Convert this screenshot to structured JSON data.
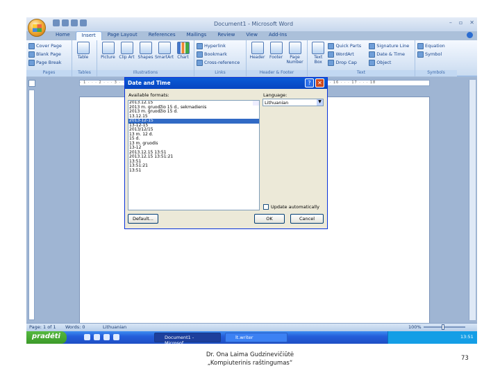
{
  "window": {
    "title": "Document1 - Microsoft Word",
    "controls": [
      "–",
      "▫",
      "✕"
    ]
  },
  "ribbon": {
    "tabs": [
      "Home",
      "Insert",
      "Page Layout",
      "References",
      "Mailings",
      "Review",
      "View",
      "Add-Ins"
    ],
    "active_tab": "Insert",
    "pages": {
      "items": [
        "Cover Page",
        "Blank Page",
        "Page Break"
      ],
      "title": "Pages"
    },
    "tables": {
      "items": [
        "Table"
      ],
      "title": "Tables"
    },
    "illustrations": {
      "items": [
        "Picture",
        "Clip Art",
        "Shapes",
        "SmartArt",
        "Chart"
      ],
      "title": "Illustrations"
    },
    "links": {
      "items": [
        "Hyperlink",
        "Bookmark",
        "Cross-reference"
      ],
      "title": "Links"
    },
    "header_footer": {
      "items": [
        "Header",
        "Footer",
        "Page Number"
      ],
      "title": "Header & Footer"
    },
    "text": {
      "items": [
        "Text Box",
        "Quick Parts",
        "WordArt",
        "Drop Cap",
        "Signature Line",
        "Date & Time",
        "Object"
      ],
      "title": "Text"
    },
    "symbols": {
      "items": [
        "Equation",
        "Symbol"
      ],
      "title": "Symbols"
    }
  },
  "status": {
    "page": "Page: 1 of 1",
    "words": "Words: 0",
    "language": "Lithuanian",
    "zoom": "100%"
  },
  "taskbar": {
    "start": "pradėti",
    "tasks": [
      "Document1 - Microsof...",
      "lt.writer"
    ],
    "time": "13:51"
  },
  "dialog": {
    "title": "Date and Time",
    "formats_label": "Available formats:",
    "formats": [
      "2013.12.15",
      "2013 m. gruodžio 15 d., sekmadienis",
      "2013 m. gruodžio 15 d.",
      "13.12.15",
      "2013-12-15",
      "13-12-15",
      "2013/12/15",
      "13 m. 12 d.",
      "15 d.",
      "13 m. gruodis",
      "13-12",
      "2013.12.15 13:51",
      "2013.12.15 13:51:21",
      "13:51",
      "13:51:21",
      "13:51"
    ],
    "selected_index": 4,
    "language_label": "Language:",
    "language_value": "Lithuanian",
    "auto_update_label": "Update automatically",
    "default_button": "Default...",
    "ok_button": "OK",
    "cancel_button": "Cancel"
  },
  "footer": {
    "line1": "Dr. Ona Laima Gudzinevičiūtė",
    "line2": "„Kompiuterinis raštingumas“",
    "page_number": "73"
  }
}
